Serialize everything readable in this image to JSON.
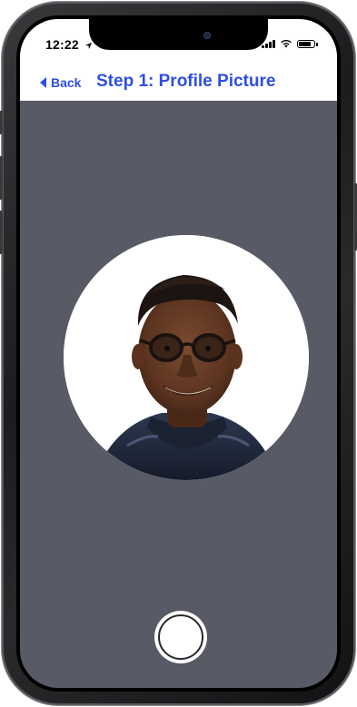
{
  "status_bar": {
    "time": "12:22",
    "location_icon": "location-arrow-icon",
    "signal_icon": "cellular-signal-icon",
    "wifi_icon": "wifi-icon",
    "battery_icon": "battery-icon",
    "battery_level": 0.85
  },
  "nav": {
    "back_label": "Back",
    "back_icon": "chevron-left-icon",
    "title": "Step 1: Profile Picture"
  },
  "profile_photo": {
    "description_icon": "person-photo"
  },
  "capture": {
    "icon": "shutter-button-icon"
  },
  "colors": {
    "accent": "#2f4fe0",
    "screen_background": "#585a66",
    "header_background": "#ffffff"
  }
}
